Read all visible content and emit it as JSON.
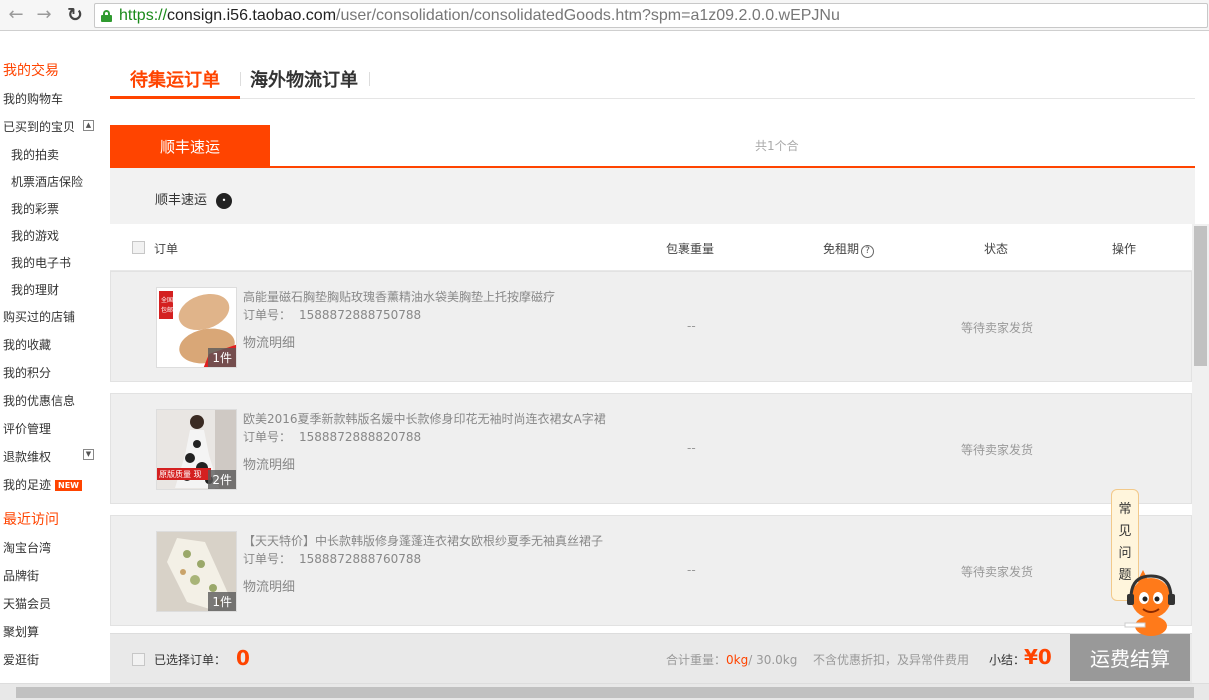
{
  "browser": {
    "url_scheme": "https://",
    "url_host": "consign.i56.taobao.com",
    "url_path": "/user/consolidation/consolidatedGoods.htm?spm=a1z09.2.0.0.wEPJNu"
  },
  "sidebar": {
    "section1": "我的交易",
    "items": [
      "我的购物车",
      "已买到的宝贝",
      "我的拍卖",
      "机票酒店保险",
      "我的彩票",
      "我的游戏",
      "我的电子书",
      "我的理财",
      "购买过的店铺",
      "我的收藏",
      "我的积分",
      "我的优惠信息",
      "评价管理",
      "退款维权",
      "我的足迹"
    ],
    "new_badge": "NEW",
    "section2": "最近访问",
    "recent": [
      "淘宝台湾",
      "品牌街",
      "天猫会员",
      "聚划算",
      "爱逛街"
    ]
  },
  "tabs": {
    "active": "待集运订单",
    "inactive": "海外物流订单"
  },
  "carrier": {
    "tab_label": "顺丰速运",
    "package_count": "共1个合",
    "name": "顺丰速运"
  },
  "table": {
    "col_order": "订单",
    "col_weight": "包裹重量",
    "col_free": "免租期",
    "col_status": "状态",
    "col_action": "操作"
  },
  "orders": [
    {
      "title": "高能量磁石胸垫胸贴玫瑰香薰精油水袋美胸垫上托按摩磁疗",
      "order_label": "订单号：",
      "order_no": "1588872888750788",
      "logistics": "物流明细",
      "qty": "1件",
      "weight": "--",
      "status": "等待卖家发货"
    },
    {
      "title": "欧美2016夏季新款韩版名媛中长款修身印花无袖时尚连衣裙女A字裙",
      "order_label": "订单号：",
      "order_no": "1588872888820788",
      "logistics": "物流明细",
      "qty": "2件",
      "weight": "--",
      "status": "等待卖家发货"
    },
    {
      "title": "【天天特价】中长款韩版修身蓬蓬连衣裙女欧根纱夏季无袖真丝裙子",
      "order_label": "订单号：",
      "order_no": "1588872888760788",
      "logistics": "物流明细",
      "qty": "1件",
      "weight": "--",
      "status": "等待卖家发货"
    }
  ],
  "footer": {
    "selected_label": "已选择订单：",
    "selected_count": "0",
    "total_label": "合计重量：",
    "total_weight": "0kg",
    "total_max": "/ 30.0kg",
    "note": "不含优惠折扣，及异常件费用",
    "subtotal_label": "小结：",
    "amount": "¥0",
    "pay_label": "运费结算"
  },
  "faq": [
    "常",
    "见",
    "问",
    "题"
  ],
  "colors": {
    "accent": "#ff4400"
  }
}
